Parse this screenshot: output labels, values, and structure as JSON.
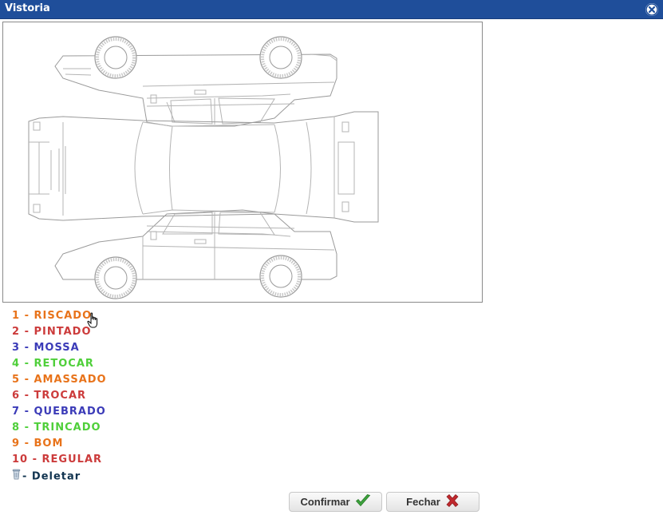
{
  "window": {
    "title": "Vistoria"
  },
  "legend": [
    {
      "label": "1 - RISCADO",
      "color": "#e8731a"
    },
    {
      "label": "2 - PINTADO",
      "color": "#cc3b3b"
    },
    {
      "label": "3 - MOSSA",
      "color": "#3b3bb8"
    },
    {
      "label": "4 - RETOCAR",
      "color": "#4fcf3a"
    },
    {
      "label": "5 - AMASSADO",
      "color": "#e8731a"
    },
    {
      "label": "6 - TROCAR",
      "color": "#cc3b3b"
    },
    {
      "label": "7 - QUEBRADO",
      "color": "#3b3bb8"
    },
    {
      "label": "8 - TRINCADO",
      "color": "#4fcf3a"
    },
    {
      "label": "9 - BOM",
      "color": "#e8731a"
    },
    {
      "label": "10 - REGULAR",
      "color": "#cc3b3b"
    },
    {
      "label": "- Deletar",
      "color": "#10334f",
      "icon": "trash-icon"
    }
  ],
  "buttons": {
    "confirm": {
      "label": "Confirmar",
      "icon": "check-icon",
      "icon_color": "#3da33d"
    },
    "close": {
      "label": "Fechar",
      "icon": "x-icon",
      "icon_color": "#c0282d"
    }
  },
  "colors": {
    "titlebar": "#1f4e9a"
  }
}
